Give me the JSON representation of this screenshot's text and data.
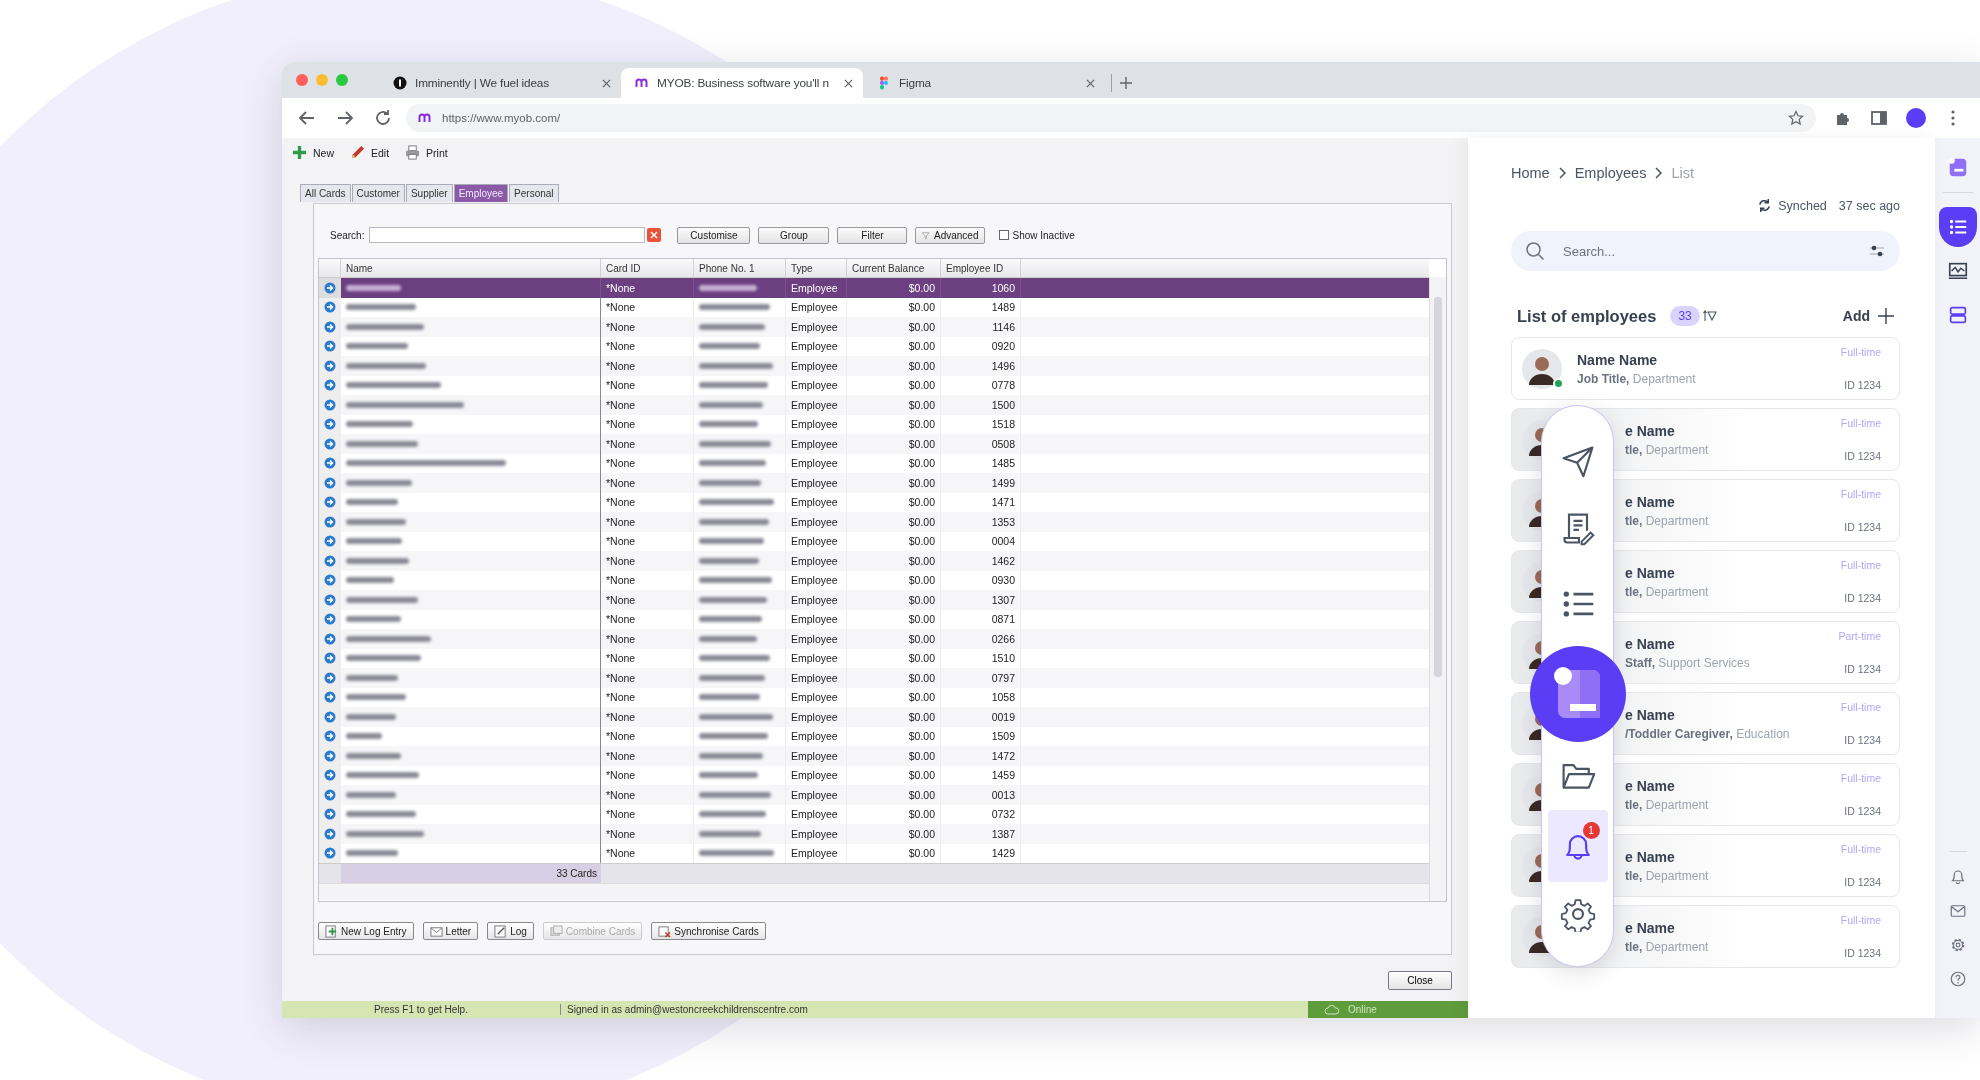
{
  "browser": {
    "tabs": [
      {
        "title": "Imminently | We fuel ideas",
        "kind": "imminently",
        "selected": false
      },
      {
        "title": "MYOB: Business software you'll n",
        "kind": "myob",
        "selected": true
      },
      {
        "title": "Figma",
        "kind": "figma",
        "selected": false
      }
    ],
    "url": "https://www.myob.com/"
  },
  "myob": {
    "toolbar": [
      {
        "label": "New",
        "kind": "new"
      },
      {
        "label": "Edit",
        "kind": "edit"
      },
      {
        "label": "Print",
        "kind": "print"
      }
    ],
    "tabs": [
      {
        "label": "All Cards",
        "selected": false
      },
      {
        "label": "Customer",
        "selected": false
      },
      {
        "label": "Supplier",
        "selected": false
      },
      {
        "label": "Employee",
        "selected": true
      },
      {
        "label": "Personal",
        "selected": false
      }
    ],
    "search": {
      "label": "Search:"
    },
    "search_buttons": [
      {
        "label": "Customise",
        "kind": "plain"
      },
      {
        "label": "Group",
        "kind": "plain"
      },
      {
        "label": "Filter",
        "kind": "plain"
      },
      {
        "label": "Advanced",
        "kind": "advanced"
      }
    ],
    "show_inactive": {
      "label": "Show Inactive",
      "checked": false
    },
    "table": {
      "columns": [
        "Name",
        "Card ID",
        "Phone No. 1",
        "Type",
        "Current Balance",
        "Employee ID"
      ],
      "rows": [
        {
          "card_id": "*None",
          "type": "Employee",
          "balance": "$0.00",
          "employee_id": "1060",
          "selected": true
        },
        {
          "card_id": "*None",
          "type": "Employee",
          "balance": "$0.00",
          "employee_id": "1489",
          "selected": false
        },
        {
          "card_id": "*None",
          "type": "Employee",
          "balance": "$0.00",
          "employee_id": "1146",
          "selected": false
        },
        {
          "card_id": "*None",
          "type": "Employee",
          "balance": "$0.00",
          "employee_id": "0920",
          "selected": false
        },
        {
          "card_id": "*None",
          "type": "Employee",
          "balance": "$0.00",
          "employee_id": "1496",
          "selected": false
        },
        {
          "card_id": "*None",
          "type": "Employee",
          "balance": "$0.00",
          "employee_id": "0778",
          "selected": false
        },
        {
          "card_id": "*None",
          "type": "Employee",
          "balance": "$0.00",
          "employee_id": "1500",
          "selected": false
        },
        {
          "card_id": "*None",
          "type": "Employee",
          "balance": "$0.00",
          "employee_id": "1518",
          "selected": false
        },
        {
          "card_id": "*None",
          "type": "Employee",
          "balance": "$0.00",
          "employee_id": "0508",
          "selected": false
        },
        {
          "card_id": "*None",
          "type": "Employee",
          "balance": "$0.00",
          "employee_id": "1485",
          "selected": false
        },
        {
          "card_id": "*None",
          "type": "Employee",
          "balance": "$0.00",
          "employee_id": "1499",
          "selected": false
        },
        {
          "card_id": "*None",
          "type": "Employee",
          "balance": "$0.00",
          "employee_id": "1471",
          "selected": false
        },
        {
          "card_id": "*None",
          "type": "Employee",
          "balance": "$0.00",
          "employee_id": "1353",
          "selected": false
        },
        {
          "card_id": "*None",
          "type": "Employee",
          "balance": "$0.00",
          "employee_id": "0004",
          "selected": false
        },
        {
          "card_id": "*None",
          "type": "Employee",
          "balance": "$0.00",
          "employee_id": "1462",
          "selected": false
        },
        {
          "card_id": "*None",
          "type": "Employee",
          "balance": "$0.00",
          "employee_id": "0930",
          "selected": false
        },
        {
          "card_id": "*None",
          "type": "Employee",
          "balance": "$0.00",
          "employee_id": "1307",
          "selected": false
        },
        {
          "card_id": "*None",
          "type": "Employee",
          "balance": "$0.00",
          "employee_id": "0871",
          "selected": false
        },
        {
          "card_id": "*None",
          "type": "Employee",
          "balance": "$0.00",
          "employee_id": "0266",
          "selected": false
        },
        {
          "card_id": "*None",
          "type": "Employee",
          "balance": "$0.00",
          "employee_id": "1510",
          "selected": false
        },
        {
          "card_id": "*None",
          "type": "Employee",
          "balance": "$0.00",
          "employee_id": "0797",
          "selected": false
        },
        {
          "card_id": "*None",
          "type": "Employee",
          "balance": "$0.00",
          "employee_id": "1058",
          "selected": false
        },
        {
          "card_id": "*None",
          "type": "Employee",
          "balance": "$0.00",
          "employee_id": "0019",
          "selected": false
        },
        {
          "card_id": "*None",
          "type": "Employee",
          "balance": "$0.00",
          "employee_id": "1509",
          "selected": false
        },
        {
          "card_id": "*None",
          "type": "Employee",
          "balance": "$0.00",
          "employee_id": "1472",
          "selected": false
        },
        {
          "card_id": "*None",
          "type": "Employee",
          "balance": "$0.00",
          "employee_id": "1459",
          "selected": false
        },
        {
          "card_id": "*None",
          "type": "Employee",
          "balance": "$0.00",
          "employee_id": "0013",
          "selected": false
        },
        {
          "card_id": "*None",
          "type": "Employee",
          "balance": "$0.00",
          "employee_id": "0732",
          "selected": false
        },
        {
          "card_id": "*None",
          "type": "Employee",
          "balance": "$0.00",
          "employee_id": "1387",
          "selected": false
        },
        {
          "card_id": "*None",
          "type": "Employee",
          "balance": "$0.00",
          "employee_id": "1429",
          "selected": false
        }
      ],
      "footer": "33 Cards"
    },
    "actions": [
      {
        "label": "New Log Entry",
        "kind": "log-entry",
        "disabled": false
      },
      {
        "label": "Letter",
        "kind": "letter",
        "disabled": false
      },
      {
        "label": "Log",
        "kind": "log",
        "disabled": false
      },
      {
        "label": "Combine Cards",
        "kind": "combine",
        "disabled": true
      },
      {
        "label": "Synchronise Cards",
        "kind": "sync",
        "disabled": false
      }
    ],
    "close": "Close",
    "status_bar": {
      "help": "Press F1 to get Help.",
      "signed_in": "Signed in as admin@westoncreekchildrenscentre.com",
      "online": "Online"
    }
  },
  "panel": {
    "breadcrumb": [
      {
        "label": "Home",
        "current": false
      },
      {
        "label": "Employees",
        "current": false
      },
      {
        "label": "List",
        "current": true
      }
    ],
    "sync": {
      "label": "Synched",
      "time": "37 sec ago"
    },
    "search": {
      "placeholder": "Search..."
    },
    "list_title": "List of employees",
    "count": "33",
    "add": "Add",
    "employees": [
      {
        "kind": "full",
        "name": "Name Name",
        "title": "Job Title,",
        "department": "Department",
        "type": "Full-time",
        "id": "ID 1234",
        "online": true
      },
      {
        "kind": "covered",
        "name": "e Name",
        "title": "tle,",
        "department": "Department",
        "type": "Full-time",
        "id": "ID 1234",
        "online": false
      },
      {
        "kind": "covered",
        "name": "e Name",
        "title": "tle,",
        "department": "Department",
        "type": "Full-time",
        "id": "ID 1234",
        "online": false
      },
      {
        "kind": "covered",
        "name": "e Name",
        "title": "tle,",
        "department": "Department",
        "type": "Full-time",
        "id": "ID 1234",
        "online": false
      },
      {
        "kind": "covered",
        "name": "e Name",
        "title": "Staff,",
        "department": "Support Services",
        "type": "Part-time",
        "id": "ID 1234",
        "online": false
      },
      {
        "kind": "covered",
        "name": "e Name",
        "title": "/Toddler Caregiver,",
        "department": "Education",
        "type": "Full-time",
        "id": "ID 1234",
        "online": false
      },
      {
        "kind": "covered",
        "name": "e Name",
        "title": "tle,",
        "department": "Department",
        "type": "Full-time",
        "id": "ID 1234",
        "online": false
      },
      {
        "kind": "covered",
        "name": "e Name",
        "title": "tle,",
        "department": "Department",
        "type": "Full-time",
        "id": "ID 1234",
        "online": false
      },
      {
        "kind": "covered",
        "name": "e Name",
        "title": "tle,",
        "department": "Department",
        "type": "Full-time",
        "id": "ID 1234",
        "online": false
      }
    ],
    "dock": [
      {
        "kind": "send",
        "selected": false
      },
      {
        "kind": "document",
        "selected": false
      },
      {
        "kind": "list",
        "selected": false
      },
      {
        "kind": "logo"
      },
      {
        "kind": "folder",
        "selected": false
      },
      {
        "kind": "bell",
        "selected": true,
        "badge": "1"
      },
      {
        "kind": "settings",
        "selected": false
      }
    ]
  },
  "rail": {
    "top": [
      {
        "kind": "logo"
      },
      {
        "kind": "list",
        "selected": true
      },
      {
        "kind": "chart",
        "selected": false
      },
      {
        "kind": "server",
        "selected": false
      }
    ],
    "bottom": [
      {
        "kind": "bell"
      },
      {
        "kind": "mail"
      },
      {
        "kind": "settings"
      },
      {
        "kind": "help"
      }
    ]
  }
}
